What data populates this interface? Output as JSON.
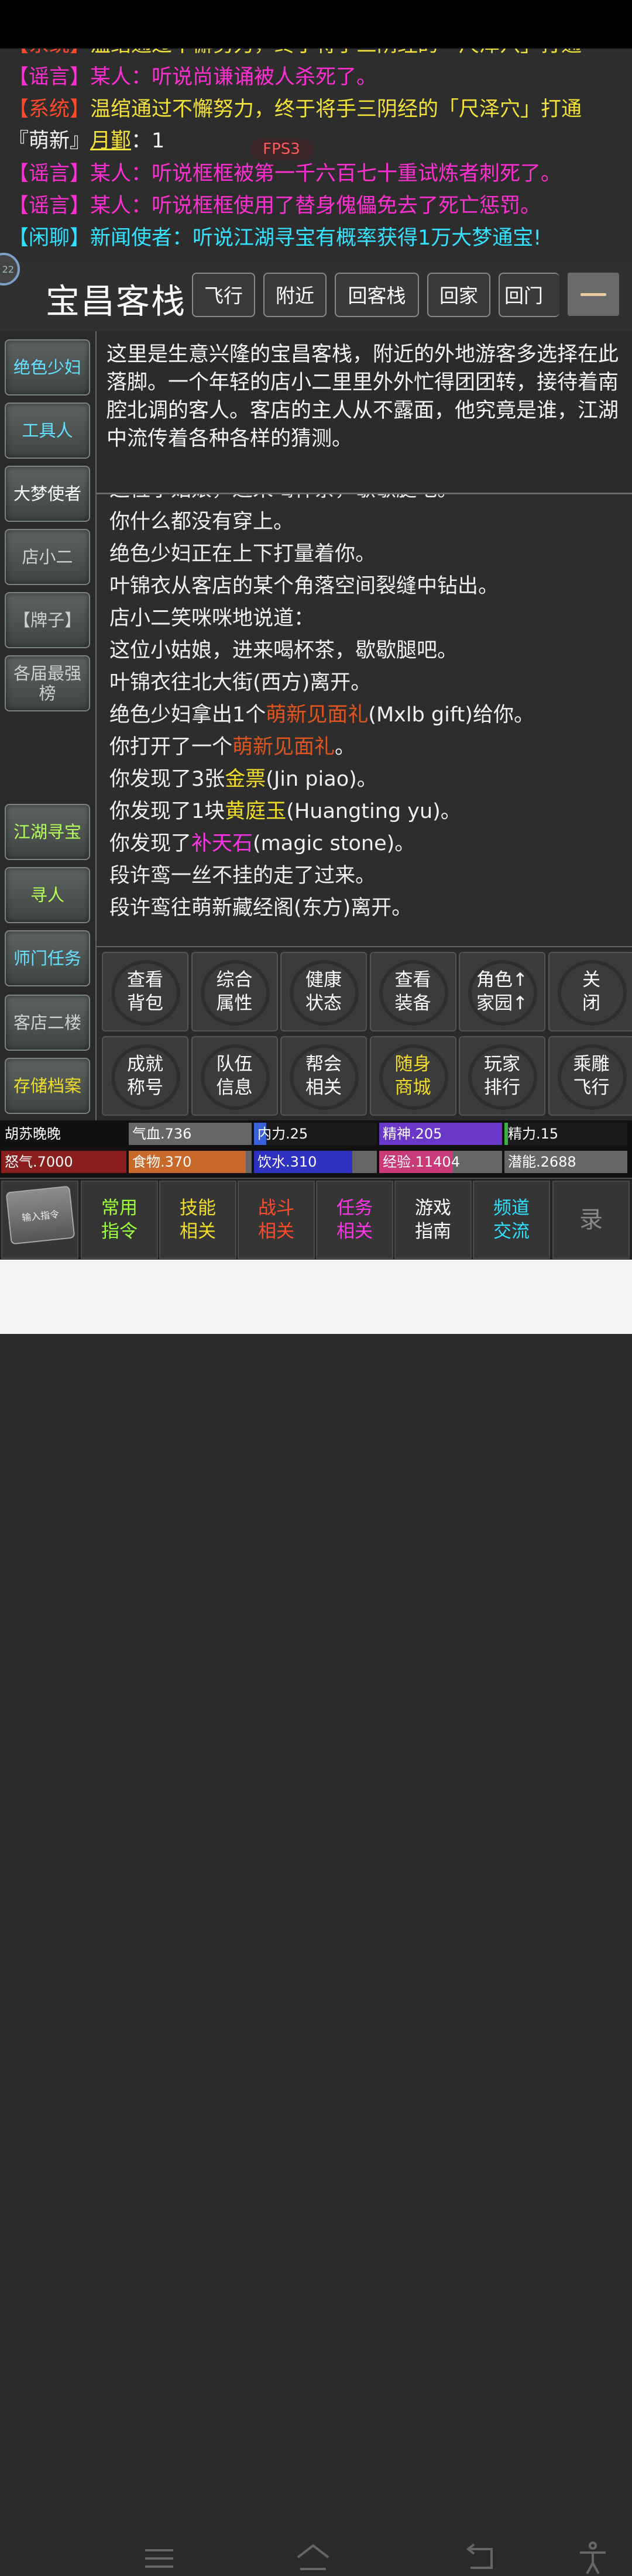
{
  "chat": [
    {
      "tag": "【系统】",
      "text": "温绾通过不懈努力，终于将手三阴经的「尺泽穴」打通",
      "type": "system-partial"
    },
    {
      "tag": "【谣言】",
      "text": "某人：听说尚谦诵被人杀死了。",
      "type": "rumor"
    },
    {
      "tag": "【系统】",
      "text": "温绾通过不懈努力，终于将手三阴经的「尺泽穴」打通",
      "type": "system"
    },
    {
      "tag": "『萌新』",
      "user": "月鄞",
      "text": "：1",
      "type": "newbie"
    },
    {
      "tag": "【谣言】",
      "text": "某人：听说框框被第一千六百七十重试炼者刺死了。",
      "type": "rumor"
    },
    {
      "tag": "【谣言】",
      "text": "某人：听说框框使用了替身傀儡免去了死亡惩罚。",
      "type": "rumor"
    },
    {
      "tag": "【闲聊】",
      "text": "新闻使者：听说江湖寻宝有概率获得1万大梦通宝!",
      "type": "chat"
    }
  ],
  "fps": "FPS3",
  "avatar_badge": "22",
  "location": {
    "title": "宝昌客栈",
    "buttons": [
      "飞行",
      "附近",
      "回客栈",
      "回家",
      "回门派"
    ]
  },
  "sidebar": [
    {
      "label": "绝色少妇",
      "color": "#66e0ff"
    },
    {
      "label": "工具人",
      "color": "#66e0ff"
    },
    {
      "label": "大梦使者",
      "color": "#ffffff"
    },
    {
      "label": "店小二",
      "color": "#d0d0d0"
    },
    {
      "label": "【牌子】",
      "color": "#d0d0d0"
    },
    {
      "label": "各届最强榜",
      "color": "#d0d0d0"
    },
    {
      "label": "江湖寻宝",
      "color": "#b6ff5a"
    },
    {
      "label": "寻人",
      "color": "#b6ff5a"
    },
    {
      "label": "师门任务",
      "color": "#66e0ff"
    },
    {
      "label": "客店二楼",
      "color": "#d0d0d0"
    },
    {
      "label": "存储档案",
      "color": "#f2de2a"
    }
  ],
  "description": "这里是生意兴隆的宝昌客栈，附近的外地游客多选择在此落脚。一个年轻的店小二里里外外忙得团团转，接待着南腔北调的客人。客店的主人从不露面，他究竟是谁，江湖中流传着各种各样的猜测。",
  "log": [
    [
      {
        "t": "这位小姑娘，进来喝杯茶，歇歇腿吧。"
      }
    ],
    [
      {
        "t": "你什么都没有穿上。"
      }
    ],
    [
      {
        "t": "绝色少妇正在上下打量着你。"
      }
    ],
    [
      {
        "t": "叶锦衣从客店的某个角落空间裂缝中钻出。"
      }
    ],
    [
      {
        "t": "店小二笑咪咪地说道："
      }
    ],
    [
      {
        "t": "这位小姑娘，进来喝杯茶，歇歇腿吧。"
      }
    ],
    [
      {
        "t": "叶锦衣往北大街(西方)离开。"
      }
    ],
    [
      {
        "t": "绝色少妇拿出1个"
      },
      {
        "t": "萌新见面礼",
        "c": "c-orange"
      },
      {
        "t": "(Mxlb gift)给你。"
      }
    ],
    [
      {
        "t": "你打开了一个"
      },
      {
        "t": "萌新见面礼",
        "c": "c-orange"
      },
      {
        "t": "。"
      }
    ],
    [
      {
        "t": "你发现了3张"
      },
      {
        "t": "金票",
        "c": "c-yellow"
      },
      {
        "t": "(Jin piao)。"
      }
    ],
    [
      {
        "t": "你发现了1块"
      },
      {
        "t": "黄庭玉",
        "c": "c-yellow"
      },
      {
        "t": "(Huangting yu)。"
      }
    ],
    [
      {
        "t": "你发现了"
      },
      {
        "t": "补天石",
        "c": "c-pink"
      },
      {
        "t": "(magic stone)。"
      }
    ],
    [
      {
        "t": "段许鸾一丝不挂的走了过来。"
      }
    ],
    [
      {
        "t": "段许鸾往萌新藏经阁(东方)离开。"
      }
    ]
  ],
  "actions": [
    {
      "l1": "查看",
      "l2": "背包",
      "color": "#ffffff"
    },
    {
      "l1": "综合",
      "l2": "属性",
      "color": "#ffffff"
    },
    {
      "l1": "健康",
      "l2": "状态",
      "color": "#ffffff"
    },
    {
      "l1": "查看",
      "l2": "装备",
      "color": "#ffffff"
    },
    {
      "l1": "角色↑",
      "l2": "家园↑",
      "color": "#ffffff"
    },
    {
      "l1": "关",
      "l2": "闭",
      "color": "#ffffff"
    },
    {
      "l1": "成就",
      "l2": "称号",
      "color": "#ffffff"
    },
    {
      "l1": "队伍",
      "l2": "信息",
      "color": "#ffffff"
    },
    {
      "l1": "帮会",
      "l2": "相关",
      "color": "#ffffff"
    },
    {
      "l1": "随身",
      "l2": "商城",
      "color": "#f2de2a"
    },
    {
      "l1": "玩家",
      "l2": "排行",
      "color": "#ffffff"
    },
    {
      "l1": "乘雕",
      "l2": "飞行",
      "color": "#ffffff"
    }
  ],
  "stats": {
    "name": "胡苏晚晚",
    "row1": [
      {
        "label": "气血.736",
        "fill": 0,
        "color": "#c54040"
      },
      {
        "label": "内力.25",
        "fill": 0.1,
        "color": "#3a62d8"
      },
      {
        "label": "精神.205",
        "fill": 1,
        "color": "#6a38c8"
      },
      {
        "label": "精力.15",
        "fill": 0.03,
        "color": "#3cb043"
      }
    ],
    "row2": [
      {
        "label": "怒气.7000",
        "fill": 1,
        "color": "#8a1e1e"
      },
      {
        "label": "食物.370",
        "fill": 0.95,
        "color": "#c8682a"
      },
      {
        "label": "饮水.310",
        "fill": 0.8,
        "color": "#2f32c0"
      },
      {
        "label": "经验.11404",
        "fill": 0.6,
        "color": "#c83a78"
      },
      {
        "label": "潜能.2688",
        "fill": 0,
        "color": "#666666"
      }
    ]
  },
  "menu": [
    {
      "l1": "常用",
      "l2": "指令",
      "color": "#9cff3a"
    },
    {
      "l1": "技能",
      "l2": "相关",
      "color": "#f2de2a"
    },
    {
      "l1": "战斗",
      "l2": "相关",
      "color": "#ff4a2b"
    },
    {
      "l1": "任务",
      "l2": "相关",
      "color": "#ff34e6"
    },
    {
      "l1": "游戏",
      "l2": "指南",
      "color": "#ffffff"
    },
    {
      "l1": "频道",
      "l2": "交流",
      "color": "#2fe0ff"
    }
  ],
  "cmd_button": "输入指令",
  "record_button": "录"
}
